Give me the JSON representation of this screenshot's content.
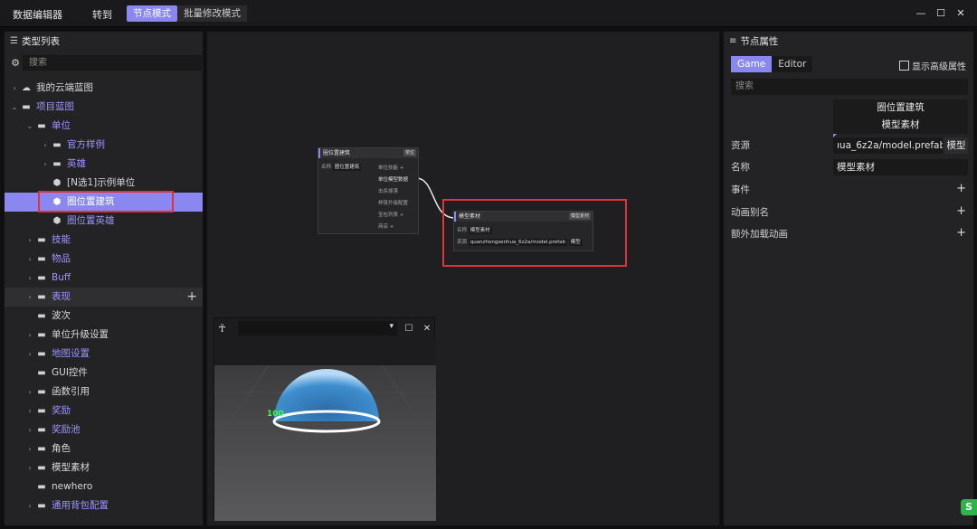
{
  "window": {
    "title": "数据编辑器",
    "goto": "转到",
    "modes": [
      "节点模式",
      "批量修改模式"
    ],
    "active_mode": 0,
    "controls": {
      "minimize": "—",
      "maximize": "☐",
      "close": "✕"
    }
  },
  "left_panel": {
    "title": "类型列表",
    "search_placeholder": "搜索",
    "items": [
      {
        "label": "我的云端蓝图",
        "depth": 0,
        "icon": "cloud-icon",
        "arrow": "›",
        "link": false
      },
      {
        "label": "项目蓝图",
        "depth": 0,
        "icon": "folder-icon",
        "arrow": "⌄",
        "link": true
      },
      {
        "label": "单位",
        "depth": 1,
        "icon": "folder-icon",
        "arrow": "⌄",
        "link": true
      },
      {
        "label": "官方样例",
        "depth": 2,
        "icon": "folder-icon",
        "arrow": "›",
        "link": true
      },
      {
        "label": "英雄",
        "depth": 2,
        "icon": "folder-icon",
        "arrow": "›",
        "link": true
      },
      {
        "label": "[N选1]示例单位",
        "depth": 2,
        "icon": "cube-icon",
        "arrow": "",
        "link": false
      },
      {
        "label": "圈位置建筑",
        "depth": 2,
        "icon": "cube-icon",
        "arrow": "",
        "link": false,
        "selected": true
      },
      {
        "label": "圈位置英雄",
        "depth": 2,
        "icon": "cube-icon",
        "arrow": "",
        "link": true
      },
      {
        "label": "技能",
        "depth": 1,
        "icon": "folder-icon",
        "arrow": "›",
        "link": true
      },
      {
        "label": "物品",
        "depth": 1,
        "icon": "folder-icon",
        "arrow": "›",
        "link": true
      },
      {
        "label": "Buff",
        "depth": 1,
        "icon": "folder-icon",
        "arrow": "›",
        "link": true
      },
      {
        "label": "表现",
        "depth": 1,
        "icon": "folder-icon",
        "arrow": "›",
        "link": true,
        "hover": true,
        "plus": "+"
      },
      {
        "label": "波次",
        "depth": 1,
        "icon": "folder-icon",
        "arrow": "",
        "link": false
      },
      {
        "label": "单位升级设置",
        "depth": 1,
        "icon": "folder-icon",
        "arrow": "›",
        "link": false
      },
      {
        "label": "地图设置",
        "depth": 1,
        "icon": "folder-icon",
        "arrow": "›",
        "link": true
      },
      {
        "label": "GUI控件",
        "depth": 1,
        "icon": "folder-icon",
        "arrow": "",
        "link": false
      },
      {
        "label": "函数引用",
        "depth": 1,
        "icon": "folder-icon",
        "arrow": "›",
        "link": false
      },
      {
        "label": "奖励",
        "depth": 1,
        "icon": "folder-icon",
        "arrow": "›",
        "link": true
      },
      {
        "label": "奖励池",
        "depth": 1,
        "icon": "folder-icon",
        "arrow": "›",
        "link": true
      },
      {
        "label": "角色",
        "depth": 1,
        "icon": "folder-icon",
        "arrow": "›",
        "link": false
      },
      {
        "label": "模型素材",
        "depth": 1,
        "icon": "folder-icon",
        "arrow": "›",
        "link": false
      },
      {
        "label": "newhero",
        "depth": 1,
        "icon": "folder-icon",
        "arrow": "",
        "link": false
      },
      {
        "label": "通用背包配置",
        "depth": 1,
        "icon": "folder-icon",
        "arrow": "›",
        "link": true
      }
    ]
  },
  "graph": {
    "node1": {
      "title": "圈位置建筑",
      "tag": "单位",
      "name_label": "名称",
      "name_value": "圈位置建筑",
      "pins": [
        "单位技能 +",
        "单位模型数据",
        "击杀掉落",
        "样筑升级配置",
        "宝包列表 +",
        "商店 +"
      ]
    },
    "node2": {
      "title": "模型素材",
      "tag": "模型素材",
      "name_label": "名称",
      "name_value": "模型素材",
      "res_label": "资源",
      "res_value": "quanzhongsenhua_6z2a/model.prefab",
      "res_btn": "模型"
    }
  },
  "viewport": {
    "hud_number": "100"
  },
  "right_panel": {
    "title": "节点属性",
    "tabs": [
      "Game",
      "Editor"
    ],
    "active_tab": 0,
    "advanced_label": "显示高级属性",
    "search_placeholder": "搜索",
    "header_line1": "圈位置建筑",
    "header_line2": "模型素材",
    "props": {
      "resource_label": "资源",
      "resource_value": "ıua_6z2a/model.prefab",
      "resource_btn": "模型",
      "name_label": "名称",
      "name_value": "模型素材",
      "event_label": "事件",
      "anim_alias_label": "动画别名",
      "extra_anim_label": "额外加载动画",
      "plus": "+"
    }
  },
  "colors": {
    "accent": "#8a87f0",
    "link": "#9b96ff",
    "highlight": "#e0323c",
    "panel": "#232325"
  }
}
